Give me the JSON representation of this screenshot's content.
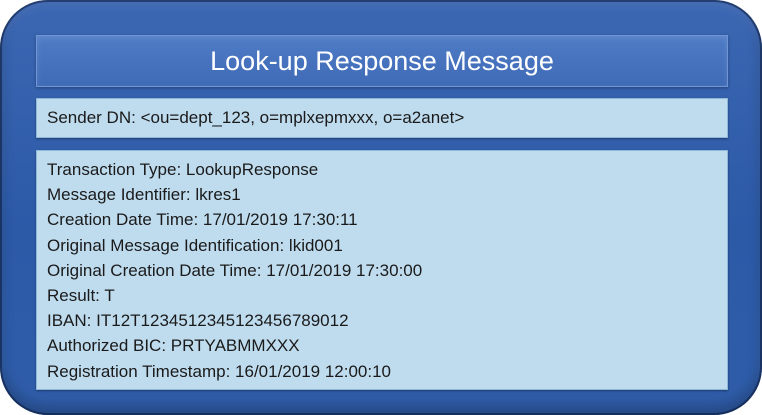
{
  "title": "Look-up Response Message",
  "sender": {
    "label": "Sender DN:",
    "value": "<ou=dept_123, o=mplxepmxxx, o=a2anet>"
  },
  "details": [
    {
      "label": "Transaction Type:",
      "value": "LookupResponse"
    },
    {
      "label": "Message Identifier:",
      "value": "lkres1"
    },
    {
      "label": "Creation Date Time:",
      "value": "17/01/2019 17:30:11"
    },
    {
      "label": "Original Message Identification:",
      "value": "lkid001"
    },
    {
      "label": "Original Creation Date Time:",
      "value": "17/01/2019 17:30:00"
    },
    {
      "label": "Result:",
      "value": "T"
    },
    {
      "label": "IBAN:",
      "value": "IT12T1234512345123456789012"
    },
    {
      "label": "Authorized BIC:",
      "value": "PRTYABMMXXX"
    },
    {
      "label": "Registration Timestamp:",
      "value": "16/01/2019 12:00:10"
    }
  ]
}
